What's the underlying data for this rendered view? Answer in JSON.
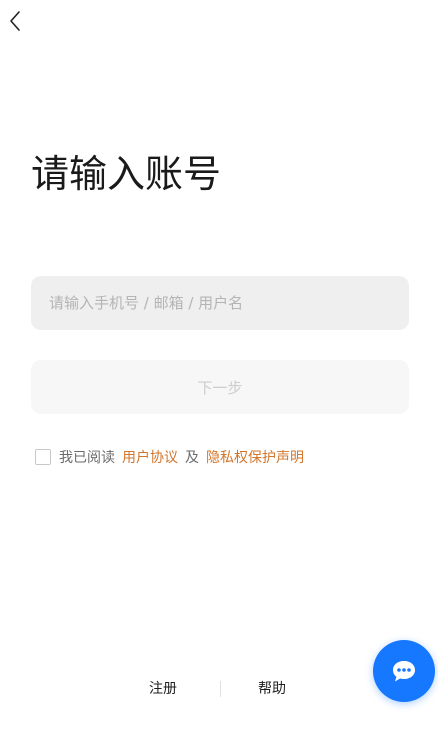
{
  "header": {
    "back_icon": "chevron-left-icon"
  },
  "page": {
    "title": "请输入账号"
  },
  "account_input": {
    "value": "",
    "placeholder": "请输入手机号 / 邮箱 / 用户名"
  },
  "next_button": {
    "label": "下一步",
    "state": "disabled"
  },
  "agreement": {
    "checked": false,
    "prefix": "我已阅读",
    "user_agreement": "用户协议",
    "and": "及",
    "privacy_policy": "隐私权保护声明"
  },
  "footer": {
    "register": "注册",
    "help": "帮助"
  },
  "chat_button": {
    "icon": "chat-bubble-icon"
  },
  "colors": {
    "link": "#d2762d",
    "accent": "#1677ff",
    "input_bg": "#efefef",
    "button_disabled_bg": "#f7f7f7"
  }
}
